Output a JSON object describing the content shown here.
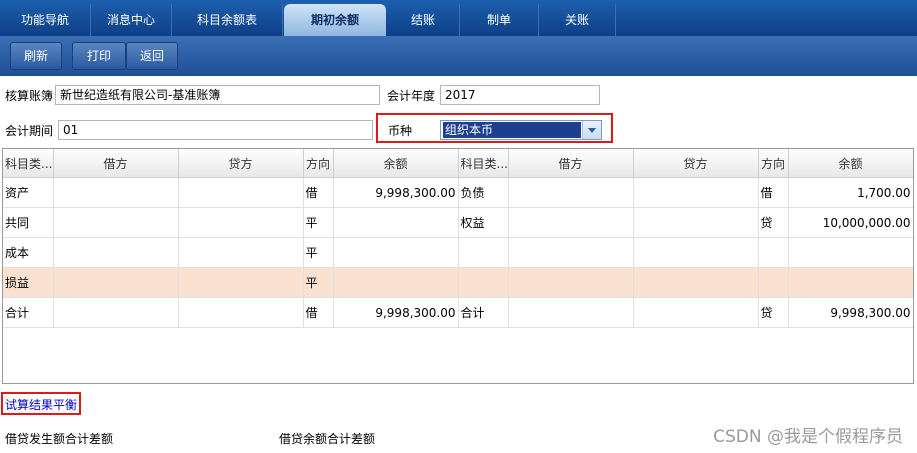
{
  "nav": {
    "tabs": [
      "功能导航",
      "消息中心",
      "科目余额表",
      "期初余额",
      "结账",
      "制单",
      "关账"
    ],
    "active_index": 3
  },
  "toolbar": {
    "refresh_label": "刷新",
    "print_label": "打印",
    "back_label": "返回"
  },
  "form": {
    "ledger_label": "核算账簿",
    "ledger_value": "新世纪造纸有限公司-基准账簿",
    "year_label": "会计年度",
    "year_value": "2017",
    "period_label": "会计期间",
    "period_value": "01",
    "currency_label": "币种",
    "currency_value": "组织本币"
  },
  "table": {
    "headers": [
      "科目类...",
      "借方",
      "贷方",
      "方向",
      "余额",
      "科目类...",
      "借方",
      "贷方",
      "方向",
      "余额"
    ],
    "rows": [
      [
        "资产",
        "",
        "",
        "借",
        "9,998,300.00",
        "负债",
        "",
        "",
        "借",
        "1,700.00"
      ],
      [
        "共同",
        "",
        "",
        "平",
        "",
        "权益",
        "",
        "",
        "贷",
        "10,000,000.00"
      ],
      [
        "成本",
        "",
        "",
        "平",
        "",
        "",
        "",
        "",
        "",
        ""
      ],
      [
        "损益",
        "",
        "",
        "平",
        "",
        "",
        "",
        "",
        "",
        ""
      ],
      [
        "合计",
        "",
        "",
        "借",
        "9,998,300.00",
        "合计",
        "",
        "",
        "贷",
        "9,998,300.00"
      ]
    ],
    "highlight_row_index": 3
  },
  "footer": {
    "result_text": "试算结果平衡",
    "diff_amount_label": "借贷发生额合计差额",
    "diff_balance_label": "借贷余额合计差额"
  },
  "watermark": "CSDN @我是个假程序员",
  "colors": {
    "nav_bg": "#0e3f86",
    "highlight_row": "#fae1d0",
    "red_annotation": "#e0191b",
    "result_link": "#0000cc"
  }
}
